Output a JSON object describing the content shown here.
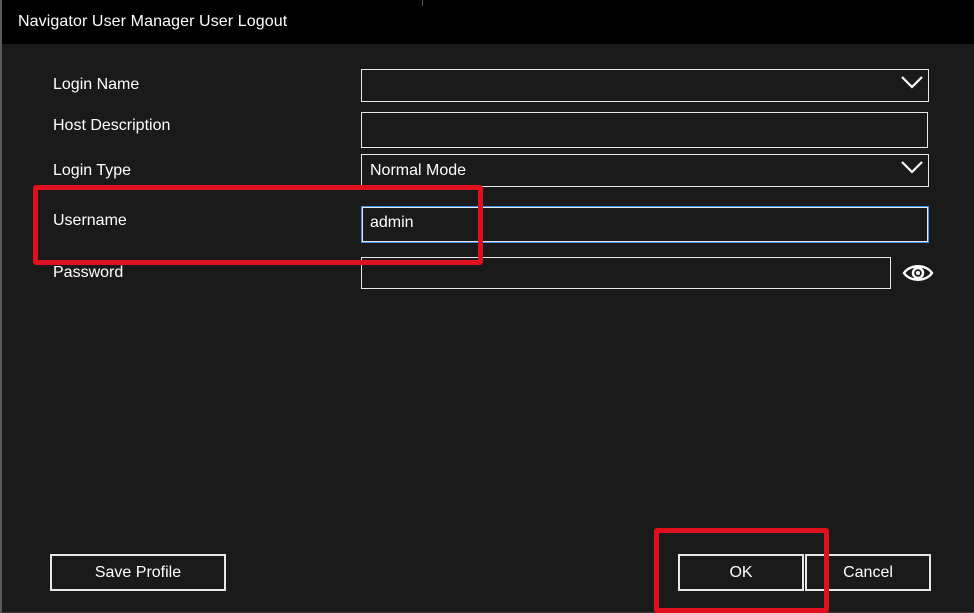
{
  "window": {
    "title": "Navigator User Manager User Logout"
  },
  "form": {
    "login_name": {
      "label": "Login Name",
      "value": ""
    },
    "host_description": {
      "label": "Host Description",
      "value": ""
    },
    "login_type": {
      "label": "Login Type",
      "value": "Normal Mode"
    },
    "username": {
      "label": "Username",
      "value": "admin"
    },
    "password": {
      "label": "Password",
      "value": ""
    }
  },
  "buttons": {
    "save_profile": "Save Profile",
    "ok": "OK",
    "cancel": "Cancel"
  },
  "icons": {
    "dropdown": "chevron-down-icon",
    "reveal_password": "eye-icon"
  },
  "colors": {
    "background": "#1a1a1a",
    "titlebar": "#000000",
    "text": "#ffffff",
    "field_border": "#e8e8e8",
    "focus_border": "#3c8ee6",
    "highlight": "#e0101e"
  }
}
